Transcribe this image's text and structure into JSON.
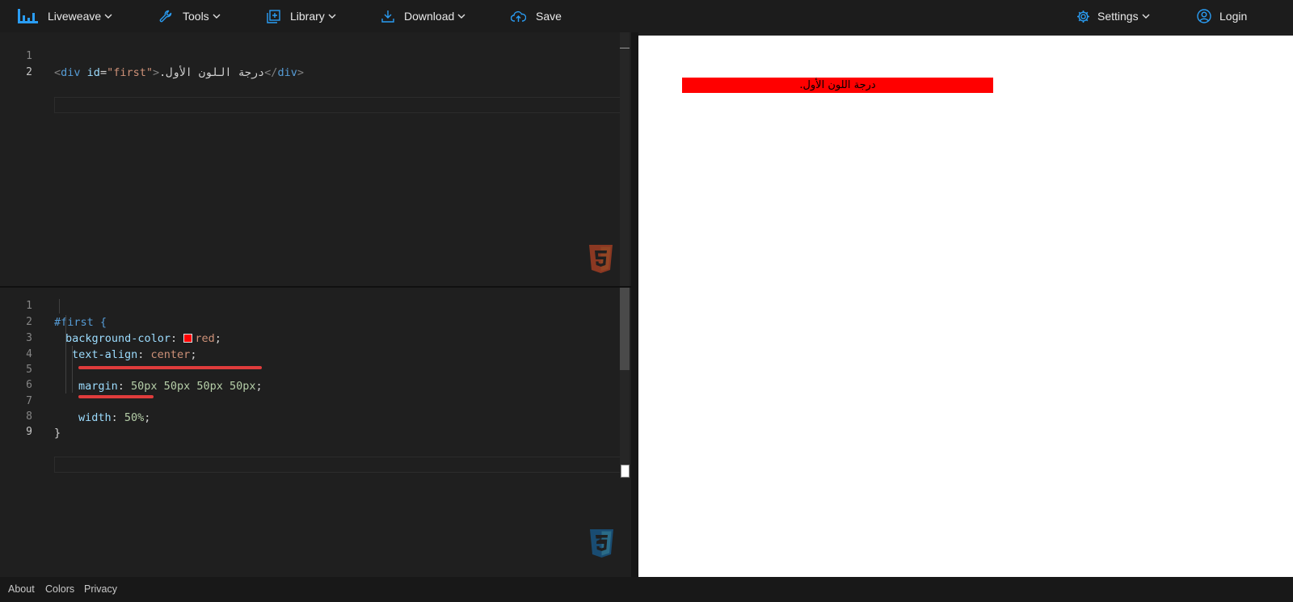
{
  "nav": {
    "brand": "Liveweave",
    "tools": "Tools",
    "library": "Library",
    "download": "Download",
    "save": "Save",
    "settings": "Settings",
    "login": "Login"
  },
  "colors": {
    "accent": "#2a9df4",
    "editor_bg": "#1f1f1f",
    "preview_bg": "#ffffff",
    "preview_div_bg": "#ff0000",
    "underline": "#e03c3c"
  },
  "html_editor": {
    "lines": [
      {
        "num": "1",
        "open_lt": "<",
        "tag": "div",
        "attr": "id",
        "eq": "=",
        "str": "\"first\"",
        "gt": ">",
        "text": "درجة اللون الأول.",
        "close_lt": "</",
        "close_tag": "div",
        "close_gt": ">"
      },
      {
        "num": "2"
      }
    ],
    "badge": "html5-icon"
  },
  "css_editor": {
    "lines": [
      {
        "num": "1",
        "code": "#first {"
      },
      {
        "num": "2",
        "prop": "background-color",
        "value": "red"
      },
      {
        "num": "3",
        "prop": "text-align",
        "value": "center"
      },
      {
        "num": "4"
      },
      {
        "num": "5",
        "prop": "margin",
        "value": "50px 50px 50px 50px"
      },
      {
        "num": "6"
      },
      {
        "num": "7",
        "prop": "width",
        "value": "50%"
      },
      {
        "num": "8",
        "code": "}"
      },
      {
        "num": "9"
      }
    ],
    "badge": "css3-icon"
  },
  "preview": {
    "div_text": "درجة اللون الأول."
  },
  "footer": {
    "about": "About",
    "colors": "Colors",
    "privacy": "Privacy"
  }
}
